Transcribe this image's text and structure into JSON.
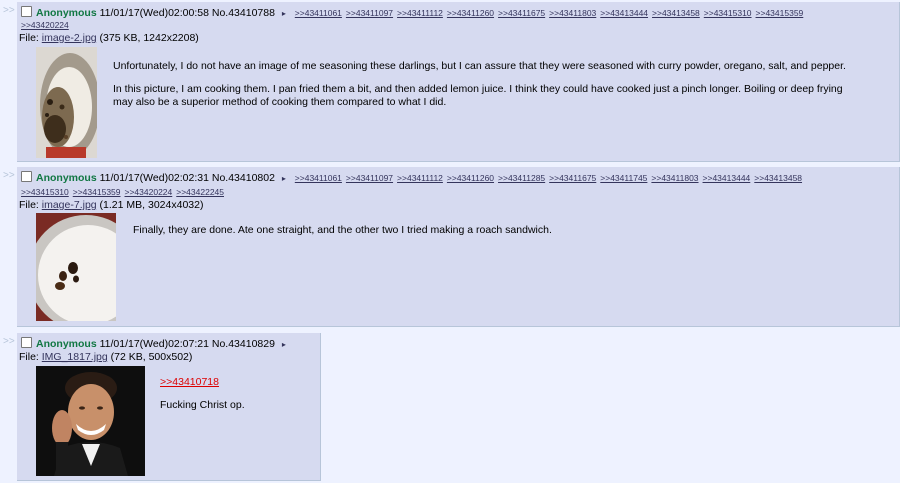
{
  "separator": ">>",
  "menu_glyph": "▸",
  "posts": [
    {
      "name": "Anonymous",
      "datetime": "11/01/17(Wed)02:00:58",
      "post_no": "No.43410788",
      "backlinks": [
        ">>43411061",
        ">>43411097",
        ">>43411112",
        ">>43411260",
        ">>43411675",
        ">>43411803",
        ">>43413444",
        ">>43413458",
        ">>43415310",
        ">>43415359"
      ],
      "backlinks_line2": [
        ">>43420224"
      ],
      "file_label": "File: ",
      "file_name": "image-2.jpg",
      "file_meta": " (375 KB, 1242x2208)",
      "message": [
        "Unfortunately, I do not have an image of me seasoning these darlings, but I can assure that they were seasoned with curry powder, oregano, salt, and pepper.",
        "In this picture, I am cooking them. I pan fried them a bit, and then added lemon juice. I think they could have cooked just a pinch longer. Boiling or deep frying may also be a superior method of cooking them compared to what I did."
      ]
    },
    {
      "name": "Anonymous",
      "datetime": "11/01/17(Wed)02:02:31",
      "post_no": "No.43410802",
      "backlinks": [
        ">>43411061",
        ">>43411097",
        ">>43411112",
        ">>43411260",
        ">>43411285",
        ">>43411675",
        ">>43411745",
        ">>43411803",
        ">>43413444",
        ">>43413458"
      ],
      "backlinks_line2": [
        ">>43415310",
        ">>43415359",
        ">>43420224",
        ">>43422245"
      ],
      "file_label": "File: ",
      "file_name": "image-7.jpg",
      "file_meta": " (1.21 MB, 3024x4032)",
      "message": [
        "Finally, they are done. Ate one straight, and the other two I tried making a roach sandwich."
      ]
    },
    {
      "name": "Anonymous",
      "datetime": "11/01/17(Wed)02:07:21",
      "post_no": "No.43410829",
      "backlinks": [],
      "file_label": "File: ",
      "file_name": "IMG_1817.jpg",
      "file_meta": " (72 KB, 500x502)",
      "quote": ">>43410718",
      "message": [
        "Fucking Christ op."
      ]
    }
  ],
  "colors": {
    "page_bg": "#eef2ff",
    "post_bg": "#d6daf0",
    "name": "#117743",
    "link": "#34345c",
    "quote": "#dd0000"
  }
}
